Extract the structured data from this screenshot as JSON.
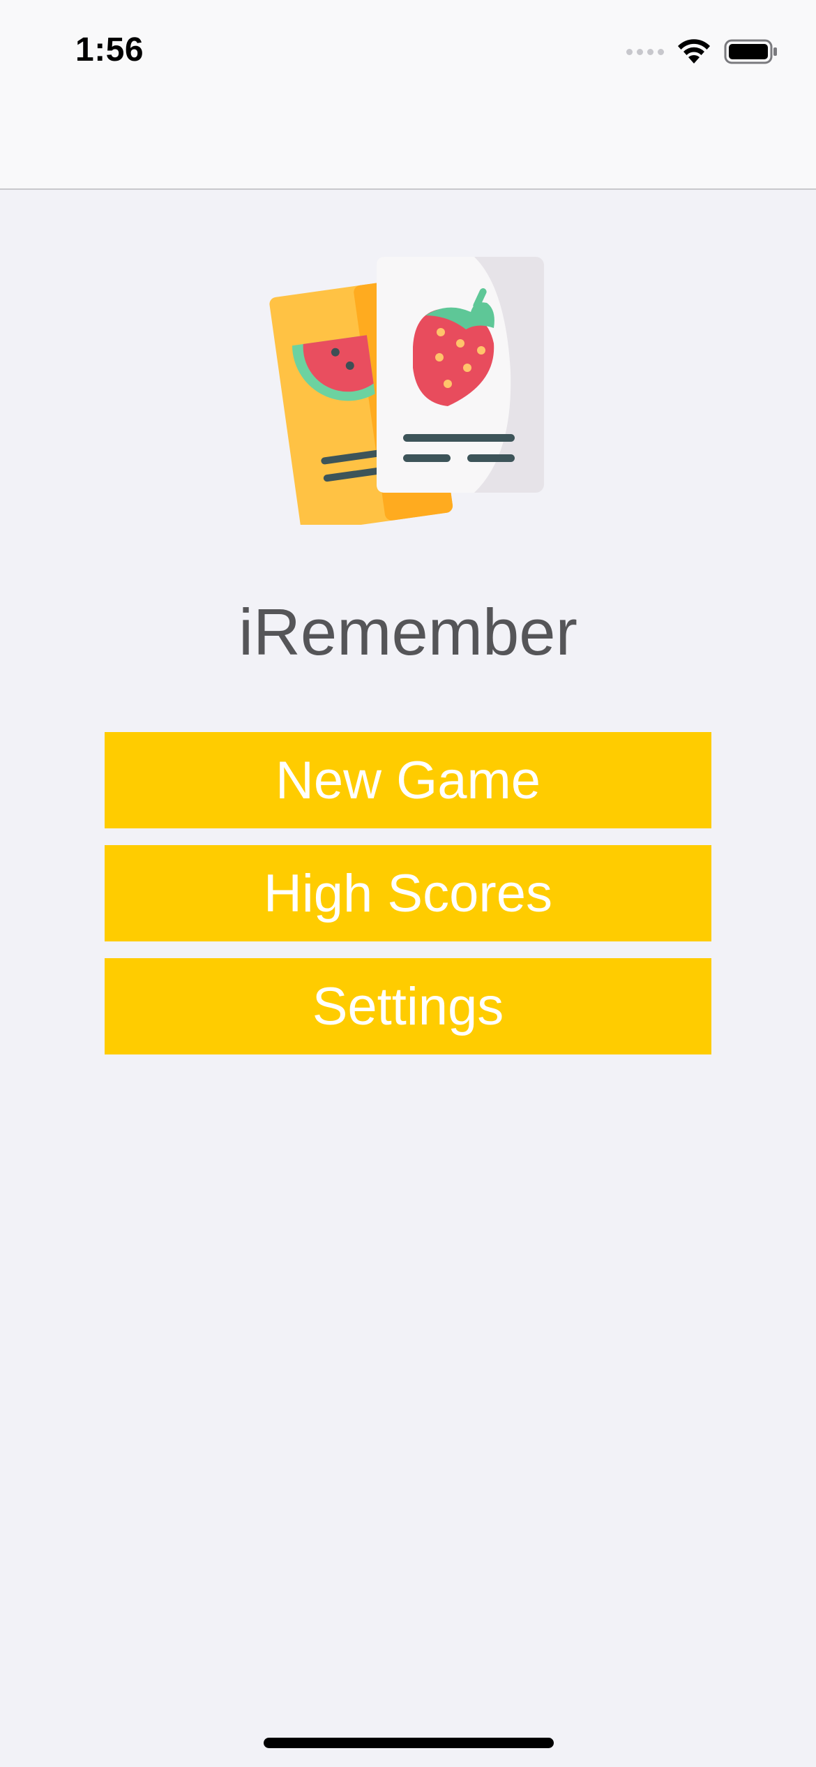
{
  "status_bar": {
    "time": "1:56",
    "icons": [
      "cellular-signal-icon",
      "wifi-icon",
      "battery-icon"
    ]
  },
  "app": {
    "title": "iRemember",
    "logo": "memory-cards-logo",
    "accent_color": "#ffcc00",
    "background_color": "#f2f2f7"
  },
  "menu": {
    "new_game_label": "New Game",
    "high_scores_label": "High Scores",
    "settings_label": "Settings"
  }
}
